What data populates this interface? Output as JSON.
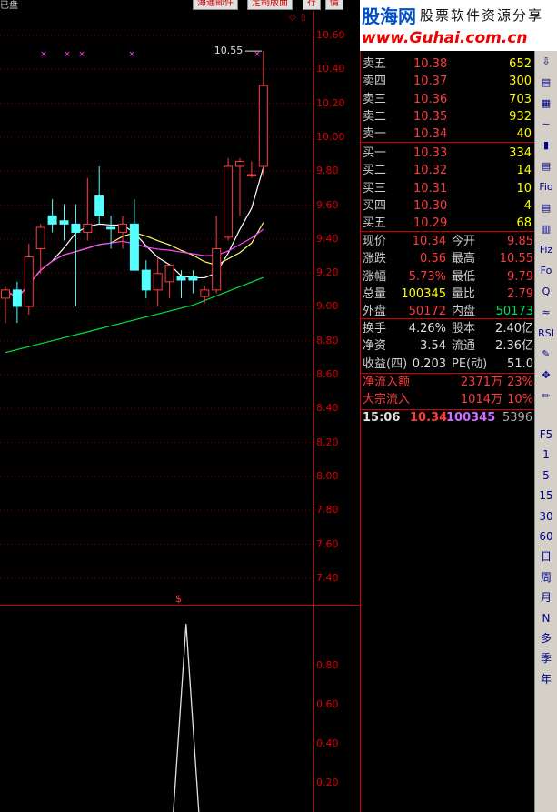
{
  "top_buttons": [
    "海通邮件",
    "定制版面",
    "行",
    "情"
  ],
  "top_left_text": "已盘",
  "logo": {
    "brand": "股海网",
    "slogan": "股票软件资源分享",
    "url": "www.Guhai.com.cn"
  },
  "price_axis": [
    "10.60",
    "10.40",
    "10.20",
    "10.00",
    "9.80",
    "9.60",
    "9.40",
    "9.20",
    "9.00",
    "8.80",
    "8.60",
    "8.40",
    "8.20",
    "8.00",
    "7.80",
    "7.60",
    "7.40"
  ],
  "indicator_axis": [
    "0.80",
    "0.60",
    "0.40",
    "0.20"
  ],
  "high_marker": "10.55",
  "indicator_marker": "$",
  "order_book": {
    "asks": [
      {
        "label": "卖五",
        "price": "10.38",
        "vol": "652"
      },
      {
        "label": "卖四",
        "price": "10.37",
        "vol": "300"
      },
      {
        "label": "卖三",
        "price": "10.36",
        "vol": "703"
      },
      {
        "label": "卖二",
        "price": "10.35",
        "vol": "932"
      },
      {
        "label": "卖一",
        "price": "10.34",
        "vol": "40"
      }
    ],
    "bids": [
      {
        "label": "买一",
        "price": "10.33",
        "vol": "334"
      },
      {
        "label": "买二",
        "price": "10.32",
        "vol": "14"
      },
      {
        "label": "买三",
        "price": "10.31",
        "vol": "10"
      },
      {
        "label": "买四",
        "price": "10.30",
        "vol": "4"
      },
      {
        "label": "买五",
        "price": "10.29",
        "vol": "68"
      }
    ]
  },
  "quote": {
    "r1": {
      "l1": "现价",
      "v1": "10.34",
      "l2": "今开",
      "v2": "9.85"
    },
    "r2": {
      "l1": "涨跌",
      "v1": "0.56",
      "l2": "最高",
      "v2": "10.55"
    },
    "r3": {
      "l1": "涨幅",
      "v1": "5.73%",
      "l2": "最低",
      "v2": "9.79"
    },
    "r4": {
      "l1": "总量",
      "v1": "100345",
      "l2": "量比",
      "v2": "2.79"
    },
    "r5": {
      "l1": "外盘",
      "v1": "50172",
      "l2": "内盘",
      "v2": "50173"
    }
  },
  "fundamentals": {
    "r1": {
      "l1": "换手",
      "v1": "4.26%",
      "l2": "股本",
      "v2": "2.40亿"
    },
    "r2": {
      "l1": "净资",
      "v1": "3.54",
      "l2": "流通",
      "v2": "2.36亿"
    },
    "r3": {
      "l1": "收益(四)",
      "v1": "0.203",
      "l2": "PE(动)",
      "v2": "51.0"
    }
  },
  "flow": {
    "r1": {
      "l": "净流入额",
      "v": "2371万",
      "p": "23%"
    },
    "r2": {
      "l": "大宗流入",
      "v": "1014万",
      "p": "10%"
    }
  },
  "tick": {
    "time": "15:06",
    "price": "10.34",
    "vol": "100345",
    "extra": "5396"
  },
  "toolbar": [
    "⇩",
    "▤",
    "▦",
    "∼",
    "▮",
    "▤",
    "Fio",
    "▤",
    "▥",
    "Fiz",
    "Fo",
    "Q",
    "≈",
    "RSI",
    "✎",
    "✥",
    "✏",
    "F5",
    "1",
    "5",
    "15",
    "30",
    "60",
    "日",
    "周",
    "月",
    "N",
    "多",
    "季",
    "年"
  ],
  "chart_data": {
    "type": "candlestick",
    "ylim": [
      7.3,
      10.65
    ],
    "candles": [
      {
        "o": 9.05,
        "h": 9.12,
        "l": 8.9,
        "c": 9.1
      },
      {
        "o": 9.1,
        "h": 9.15,
        "l": 8.9,
        "c": 9.0
      },
      {
        "o": 9.0,
        "h": 9.38,
        "l": 8.95,
        "c": 9.3
      },
      {
        "o": 9.35,
        "h": 9.5,
        "l": 9.2,
        "c": 9.48
      },
      {
        "o": 9.55,
        "h": 9.65,
        "l": 9.45,
        "c": 9.5
      },
      {
        "o": 9.52,
        "h": 9.62,
        "l": 9.4,
        "c": 9.5
      },
      {
        "o": 9.5,
        "h": 9.62,
        "l": 9.0,
        "c": 9.45
      },
      {
        "o": 9.45,
        "h": 9.78,
        "l": 9.4,
        "c": 9.5
      },
      {
        "o": 9.67,
        "h": 9.85,
        "l": 9.5,
        "c": 9.55
      },
      {
        "o": 9.48,
        "h": 9.55,
        "l": 9.35,
        "c": 9.47
      },
      {
        "o": 9.45,
        "h": 9.55,
        "l": 9.35,
        "c": 9.5
      },
      {
        "o": 9.5,
        "h": 9.65,
        "l": 9.35,
        "c": 9.22
      },
      {
        "o": 9.22,
        "h": 9.28,
        "l": 9.05,
        "c": 9.1
      },
      {
        "o": 9.1,
        "h": 9.3,
        "l": 9.0,
        "c": 9.2
      },
      {
        "o": 9.15,
        "h": 9.25,
        "l": 9.05,
        "c": 9.25
      },
      {
        "o": 9.18,
        "h": 9.22,
        "l": 9.05,
        "c": 9.16
      },
      {
        "o": 9.18,
        "h": 9.22,
        "l": 9.08,
        "c": 9.16
      },
      {
        "o": 9.06,
        "h": 9.12,
        "l": 9.02,
        "c": 9.1
      },
      {
        "o": 9.1,
        "h": 9.55,
        "l": 9.08,
        "c": 9.35
      },
      {
        "o": 9.42,
        "h": 9.9,
        "l": 9.4,
        "c": 9.85
      },
      {
        "o": 9.85,
        "h": 9.9,
        "l": 9.55,
        "c": 9.88
      },
      {
        "o": 9.8,
        "h": 9.88,
        "l": 9.78,
        "c": 9.8
      },
      {
        "o": 9.85,
        "h": 10.55,
        "l": 9.79,
        "c": 10.34
      }
    ],
    "indicator": {
      "ylim": [
        0,
        1
      ],
      "peak_index": 22
    }
  }
}
